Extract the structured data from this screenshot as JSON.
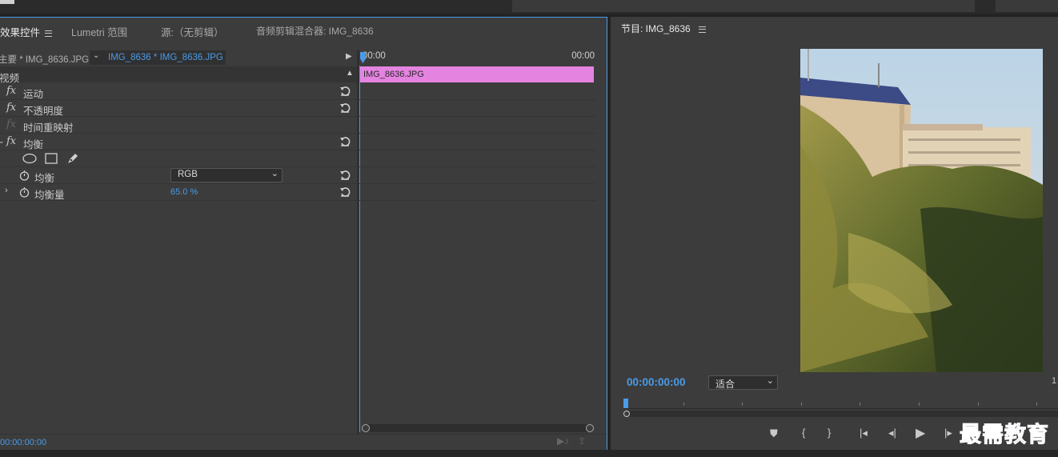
{
  "effects_panel": {
    "tabs": [
      {
        "label": "效果控件",
        "active": true
      },
      {
        "label": "Lumetri 范围"
      },
      {
        "label": "源:（无剪辑）"
      },
      {
        "label": "音频剪辑混合器: IMG_8636"
      }
    ],
    "source_breadcrumb": {
      "master": "主要 * IMG_8636.JPG",
      "sequence_clip": "IMG_8636 * IMG_8636.JPG"
    },
    "section": "视频",
    "effects": [
      {
        "name": "运动",
        "fx_enabled": true
      },
      {
        "name": "不透明度",
        "fx_enabled": true
      },
      {
        "name": "时间重映射",
        "fx_enabled": false
      },
      {
        "name": "均衡",
        "fx_enabled": true
      }
    ],
    "params": [
      {
        "name": "均衡",
        "value": "RGB",
        "type": "dropdown"
      },
      {
        "name": "均衡量",
        "value": "65.0 %",
        "type": "number"
      }
    ],
    "timeline": {
      "start_time": "00:00",
      "end_time": "00:00",
      "clip_name": "IMG_8636.JPG",
      "clip_color": "#e583e0"
    },
    "timecode": "00:00:00:00"
  },
  "program_monitor": {
    "title": "节目: IMG_8636",
    "timecode": "00:00:00:00",
    "zoom": "适合",
    "right_edge_text": "1"
  },
  "watermark": "最需教育",
  "colors": {
    "accent_blue": "#4a9be8",
    "panel_bg": "#3c3c3c",
    "clip_pink": "#e583e0"
  }
}
